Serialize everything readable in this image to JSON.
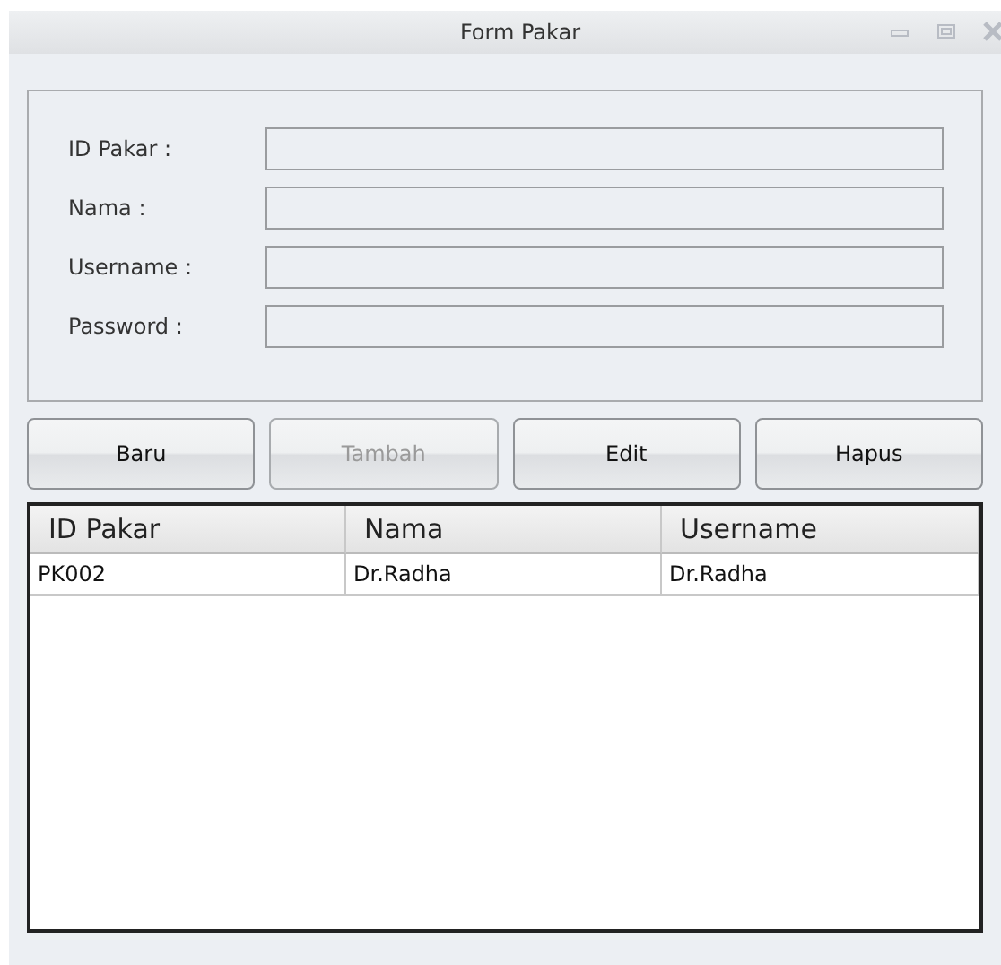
{
  "window": {
    "title": "Form Pakar"
  },
  "fields": [
    {
      "label": "ID Pakar :"
    },
    {
      "label": "Nama :"
    },
    {
      "label": "Username :"
    },
    {
      "label": "Password :"
    }
  ],
  "buttons": [
    {
      "label": "Baru",
      "disabled": false
    },
    {
      "label": "Tambah",
      "disabled": true
    },
    {
      "label": "Edit",
      "disabled": false
    },
    {
      "label": "Hapus",
      "disabled": false
    }
  ],
  "table": {
    "columns": [
      "ID Pakar",
      "Nama",
      "Username"
    ],
    "rows": [
      [
        "PK002",
        "Dr.Radha",
        "Dr.Radha"
      ]
    ]
  }
}
